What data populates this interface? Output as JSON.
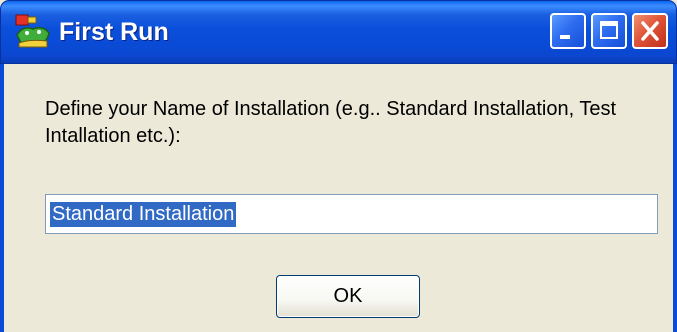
{
  "window": {
    "title": "First Run",
    "title_icon": "app-icon",
    "controls": [
      "minimize-icon",
      "maximize-icon",
      "close-icon"
    ]
  },
  "dialog": {
    "prompt": "Define your Name of Installation (e.g.. Standard Installation, Test Intallation etc.):",
    "input": {
      "value": "Standard Installation",
      "selected": true
    },
    "ok_label": "OK"
  },
  "colors": {
    "titlebar": "#0A4BD6",
    "dialog_bg": "#ECE9D8",
    "selection": "#316AC5",
    "close_button": "#E0553A"
  }
}
